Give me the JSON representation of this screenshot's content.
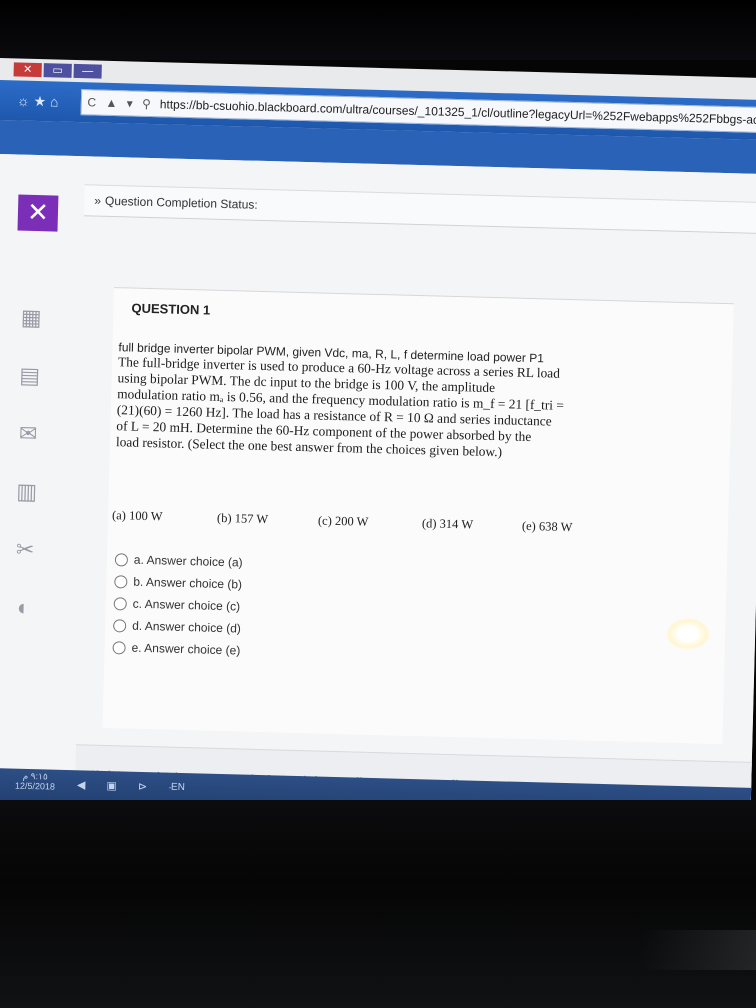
{
  "browser": {
    "url": "https://bb-csuohio.blackboard.com/ultra/courses/_101325_1/cl/outline?legacyUrl=%252Fwebapps%252Fbbgs-acc",
    "nav_icons": "☼ ★ ⌂",
    "address_icons": "C ▲ ▾ ⚲"
  },
  "status": {
    "chevron": "»",
    "label": "Question Completion Status:"
  },
  "question": {
    "title": "QUESTION 1",
    "header": "full bridge inverter bipolar PWM, given Vdc, ma, R, L, f determine load power P1",
    "lines": [
      "The full-bridge inverter is used to produce a 60-Hz voltage across a series RL load",
      "using bipolar PWM. The dc input to the bridge is 100 V, the amplitude",
      "modulation ratio mₐ is 0.56, and the frequency modulation ratio is m_f = 21 [f_tri =",
      "(21)(60) = 1260 Hz]. The load has a resistance of R = 10 Ω and series inductance",
      "of L = 20 mH. Determine the 60-Hz component of the power absorbed by the",
      "load resistor. (Select the one best answer from the choices given below.)"
    ],
    "choices": [
      "(a) 100 W",
      "(b) 157 W",
      "(c) 200 W",
      "(d) 314 W",
      "(e) 638 W"
    ],
    "answers": [
      "a. Answer choice (a)",
      "b. Answer choice (b)",
      "c. Answer choice (c)",
      "d. Answer choice (d)",
      "e. Answer choice (e)"
    ]
  },
  "footer": {
    "text": "Click Save and Submit to save and submit. Click Save All Answers to save all answers."
  },
  "taskbar": {
    "time": "٩:١٥ م",
    "date": "12/5/2018",
    "lang": "EN"
  }
}
